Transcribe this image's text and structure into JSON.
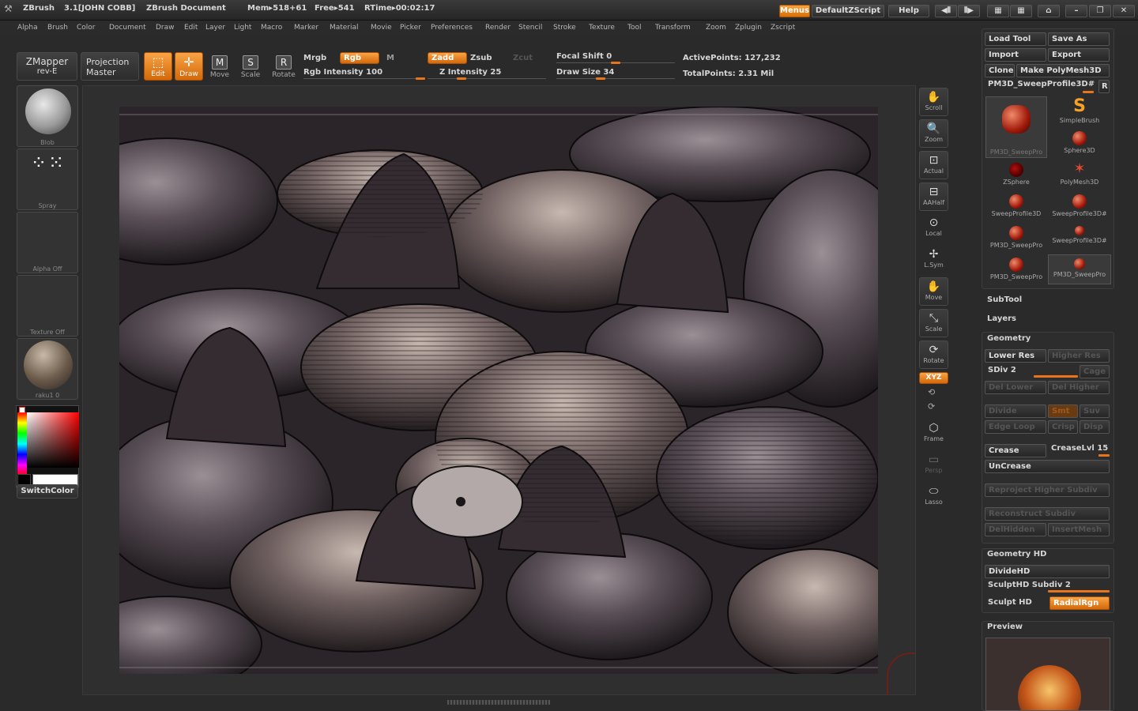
{
  "titlebar": {
    "app": "ZBrush",
    "version": "3.1[JOHN COBB]",
    "document": "ZBrush Document",
    "mem": "Mem▸518+61",
    "free": "Free▸541",
    "rtime": "RTime▸00:02:17",
    "menus_btn": "Menus",
    "zscript_btn": "DefaultZScript",
    "help_btn": "Help"
  },
  "menubar": [
    "Alpha",
    "Brush",
    "Color",
    "Document",
    "Draw",
    "Edit",
    "Layer",
    "Light",
    "Macro",
    "Marker",
    "Material",
    "Movie",
    "Picker",
    "Preferences",
    "Render",
    "Stencil",
    "Stroke",
    "Texture",
    "Tool",
    "Transform",
    "Zoom",
    "Zplugin",
    "Zscript"
  ],
  "toolbar": {
    "zmapper": "ZMapper",
    "zmapper_sub": "rev-E",
    "projection": "Projection",
    "projection_sub": "Master",
    "edit": "Edit",
    "draw": "Draw",
    "move": "Move",
    "scale": "Scale",
    "rotate": "Rotate",
    "mrgb": "Mrgb",
    "rgb": "Rgb",
    "m": "M",
    "rgb_intensity": "Rgb Intensity 100",
    "zadd": "Zadd",
    "zsub": "Zsub",
    "zcut": "Zcut",
    "z_intensity": "Z Intensity 25",
    "focal_shift": "Focal Shift 0",
    "draw_size": "Draw Size 34",
    "active_points": "ActivePoints: 127,232",
    "total_points": "TotalPoints: 2.31  Mil"
  },
  "leftshelf": {
    "brush": "Blob",
    "stroke": "Spray",
    "alpha": "Alpha  Off",
    "texture": "Texture  Off",
    "material": "raku1 0",
    "switchcolor": "SwitchColor"
  },
  "rightstrip": [
    "Scroll",
    "Zoom",
    "Actual",
    "AAHalf",
    "Local",
    "L.Sym",
    "Move",
    "Scale",
    "Rotate",
    "XYZ",
    "Frame",
    "Persp",
    "Lasso"
  ],
  "rightpanel": {
    "load_tool": "Load Tool",
    "save_as": "Save As",
    "import": "Import",
    "export": "Export",
    "clone": "Clone",
    "make_polymesh": "Make PolyMesh3D",
    "current_tool": "PM3D_SweepProfile3D#",
    "r_btn": "R",
    "tools": [
      {
        "name": "PM3D_SweepPro",
        "icon": "sweep-icon"
      },
      {
        "name": "SimpleBrush",
        "icon": "simplebrush-icon"
      },
      {
        "name": "Sphere3D",
        "icon": "sphere-icon"
      },
      {
        "name": "ZSphere",
        "icon": "zsphere-icon"
      },
      {
        "name": "PolyMesh3D",
        "icon": "polymesh-icon"
      },
      {
        "name": "SweepProfile3D",
        "icon": "sweep-icon"
      },
      {
        "name": "SweepProfile3D#",
        "icon": "sweep-icon"
      },
      {
        "name": "PM3D_SweepPro",
        "icon": "sweep-icon"
      },
      {
        "name": "SweepProfile3D#",
        "icon": "sweep-icon"
      },
      {
        "name": "PM3D_SweepPro",
        "icon": "sweep-icon"
      },
      {
        "name": "PM3D_SweepPro",
        "icon": "sweep-icon"
      }
    ],
    "subtool": "SubTool",
    "layers": "Layers",
    "geometry": "Geometry",
    "lower_res": "Lower Res",
    "higher_res": "Higher Res",
    "sdiv": "SDiv 2",
    "cage": "Cage",
    "del_lower": "Del Lower",
    "del_higher": "Del Higher",
    "divide": "Divide",
    "smt": "Smt",
    "suv": "Suv",
    "edge_loop": "Edge Loop",
    "crisp": "Crisp",
    "disp": "Disp",
    "crease": "Crease",
    "crease_lvl": "CreaseLvl 15",
    "uncrease": "UnCrease",
    "reproject": "Reproject Higher Subdiv",
    "reconstruct": "Reconstruct Subdiv",
    "delhidden": "DelHidden",
    "insertmesh": "InsertMesh",
    "geometry_hd": "Geometry HD",
    "dividehd": "DivideHD",
    "sculpthd_subdiv": "SculptHD Subdiv 2",
    "sculpt_hd": "Sculpt HD",
    "radialrgn": "RadialRgn",
    "preview": "Preview"
  },
  "colors": {
    "accent": "#e8741c",
    "panel": "#2d2d2d",
    "bg": "#2a2a2a"
  }
}
